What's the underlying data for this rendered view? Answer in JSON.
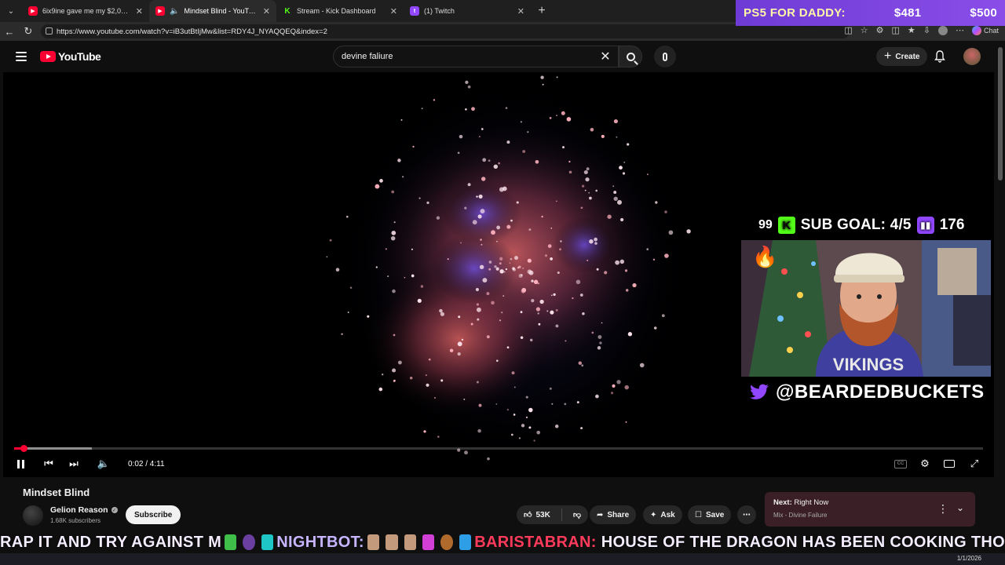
{
  "browser": {
    "tabs": [
      {
        "title": "6ix9ine gave me my $2,000,000 b...",
        "favicon": "youtube-icon",
        "active": false
      },
      {
        "title": "Mindset Blind - YouTube",
        "favicon": "youtube-icon",
        "active": true,
        "audio": true
      },
      {
        "title": "Stream - Kick Dashboard",
        "favicon": "kick-icon",
        "active": false
      },
      {
        "title": "(1) Twitch",
        "favicon": "twitch-icon",
        "active": false
      }
    ],
    "url": "https://www.youtube.com/watch?v=iB3utBtIjMw&list=RDY4J_NYAQQEQ&index=2",
    "chat_label": "Chat"
  },
  "overlay": {
    "ps5_label": "PS5 FOR DADDY:",
    "ps5_current": "$481",
    "ps5_goal": "$500",
    "left_count": "99",
    "sub_goal": "SUB GOAL: 4/5",
    "right_count": "176",
    "handle": "@BEARDEDBUCKETS"
  },
  "youtube": {
    "logo_text": "YouTube",
    "search_value": "devine faliure",
    "create_label": "Create",
    "player": {
      "time": "0:02 / 4:11",
      "progress_fraction": 0.008,
      "buffer_fraction": 0.08
    },
    "video_title": "Mindset Blind",
    "channel_name": "Gelion Reason",
    "subscribers": "1.68K subscribers",
    "subscribe_label": "Subscribe",
    "likes": "53K",
    "share_label": "Share",
    "ask_label": "Ask",
    "save_label": "Save",
    "up_next": {
      "prefix": "Next:",
      "title": "Right Now",
      "subtitle": "Mix - Divine Failure"
    }
  },
  "ticker": {
    "seg1": "RAP IT AND TRY AGAINST M",
    "user1": "NIGHTBOT:",
    "user2": "BARISTABRAN:",
    "seg2": "HOUSE OF THE DRAGON HAS BEEN COOKING THO"
  },
  "taskbar": {
    "date": "1/1/2026"
  },
  "colors": {
    "youtube_red": "#ff0033",
    "kick_green": "#53fc18",
    "twitch_purple": "#9146ff",
    "ps5_bar": "#8a4de8"
  }
}
